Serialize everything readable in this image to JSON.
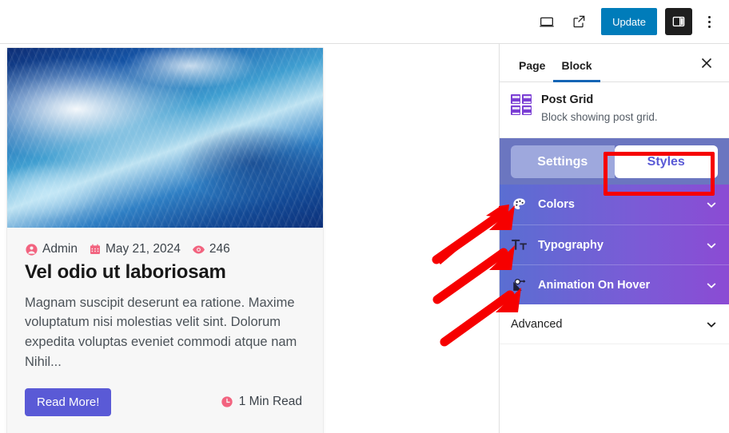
{
  "topbar": {
    "device_icon": "desktop-preview-icon",
    "external_icon": "view-external-link-icon",
    "update_label": "Update",
    "sidebar_icon": "settings-sidebar-icon",
    "options_icon": "more-options-kebab-icon"
  },
  "canvas": {
    "scroll_up_icon": "scroll-up-arrow-icon",
    "post": {
      "thumbnail_alt": "ocean-wave-photo",
      "meta": {
        "author_icon": "user-avatar-icon",
        "author": "Admin",
        "date_icon": "calendar-icon",
        "date": "May 21, 2024",
        "views_icon": "eye-icon",
        "views": "246"
      },
      "title": "Vel odio ut laboriosam",
      "excerpt": "Magnam suscipit deserunt ea ratione. Maxime voluptatum nisi molestias velit sint. Dolorum expedita voluptas eveniet commodi atque nam Nihil...",
      "read_more_label": "Read More!",
      "read_time_icon": "clock-icon",
      "read_time": "1 Min Read"
    }
  },
  "inspector": {
    "tabs": [
      {
        "label": "Page",
        "active": false
      },
      {
        "label": "Block",
        "active": true
      }
    ],
    "close_icon": "close-icon",
    "block": {
      "icon": "post-grid-icon",
      "name": "Post Grid",
      "description": "Block showing post grid."
    },
    "segmented": {
      "settings_label": "Settings",
      "styles_label": "Styles",
      "selected": "Styles"
    },
    "sections": [
      {
        "label": "Colors",
        "icon": "color-palette-icon",
        "chevron": "chevron-down-icon",
        "style": "gradient"
      },
      {
        "label": "Typography",
        "icon": "typography-icon",
        "chevron": "chevron-down-icon",
        "style": "gradient"
      },
      {
        "label": "Animation On Hover",
        "icon": "cursor-hover-icon",
        "chevron": "chevron-down-icon",
        "style": "gradient"
      },
      {
        "label": "Advanced",
        "icon": "",
        "chevron": "chevron-down-icon",
        "style": "plain"
      }
    ]
  },
  "annotations": {
    "highlight_color": "#f60000",
    "box_target": "styles-tab",
    "arrow_count": 3,
    "arrow_targets": [
      "colors-section",
      "typography-section",
      "animation-on-hover-section"
    ]
  },
  "colors": {
    "accent_blue": "#007cba",
    "brand_purple": "#5a5ad6",
    "meta_pink": "#f2637f",
    "gradient_start": "#5a6ed2",
    "gradient_end": "#8b4bd4",
    "annotation_red": "#f60000"
  }
}
